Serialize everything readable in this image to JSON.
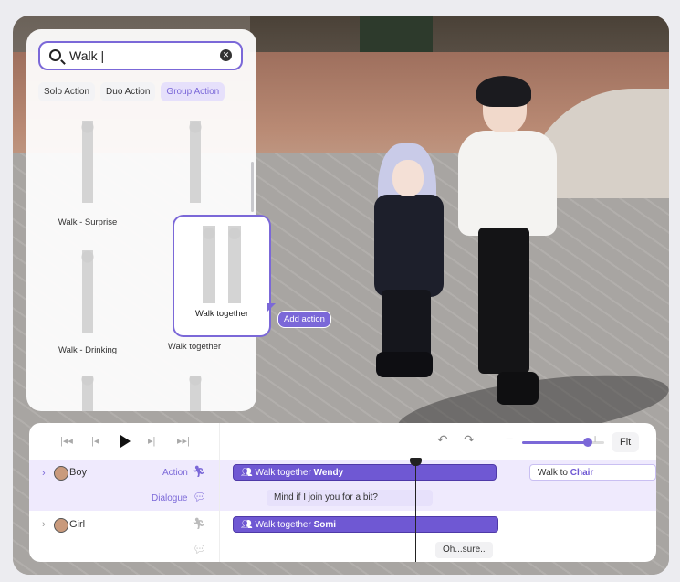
{
  "search": {
    "value": "Walk |",
    "clear_icon": "clear-icon"
  },
  "tabs": [
    "Solo Action",
    "Duo Action",
    "Group Action"
  ],
  "active_tab": "Group Action",
  "results": [
    {
      "label": "Walk - Surprise"
    },
    {
      "label": ""
    },
    {
      "label": "Walk - Drinking"
    },
    {
      "label": "Walk together"
    }
  ],
  "popup": {
    "label": "Walk together",
    "add_label": "Add action"
  },
  "timeline": {
    "fit_label": "Fit",
    "zoom_level": 0.8,
    "tracks": [
      {
        "name": "Boy",
        "action_label": "Action",
        "dialogue_label": "Dialogue"
      },
      {
        "name": "Girl"
      }
    ],
    "clips": {
      "boy_action_1": {
        "prefix": "Walk together ",
        "target": "Wendy"
      },
      "boy_action_2": {
        "prefix": "Walk to ",
        "target": "Chair"
      },
      "boy_dialogue": "Mind if I join you for a bit?",
      "girl_action": {
        "prefix": "Walk together ",
        "target": "Somi"
      },
      "girl_dialogue": "Oh...sure.."
    }
  },
  "colors": {
    "accent": "#7b68d8",
    "clip": "#6f58d3",
    "row_highlight": "#efeafd"
  }
}
